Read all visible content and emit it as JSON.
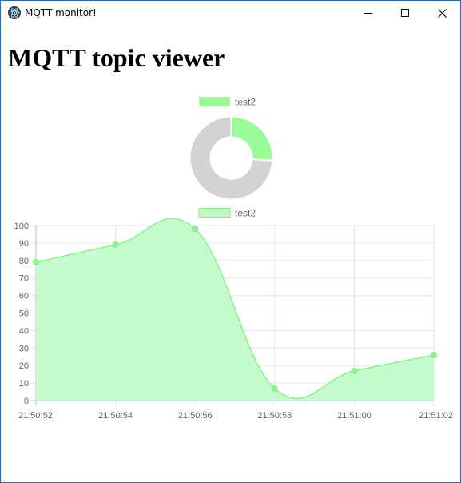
{
  "window": {
    "title": "MQTT monitor!",
    "minimize_icon": "minimize-icon",
    "maximize_icon": "maximize-icon",
    "close_icon": "close-icon",
    "app_icon": "electron-icon"
  },
  "page": {
    "heading": "MQTT topic viewer"
  },
  "chart_data": [
    {
      "type": "pie",
      "variant": "doughnut",
      "legend": [
        "test2"
      ],
      "legend_position": "top",
      "values": [
        26,
        74
      ],
      "colors": [
        "#98fb98",
        "#d3d3d3"
      ]
    },
    {
      "type": "area",
      "legend": [
        "test2"
      ],
      "legend_position": "top",
      "x": [
        "21:50:52",
        "21:50:54",
        "21:50:56",
        "21:50:58",
        "21:51:00",
        "21:51:02"
      ],
      "series": [
        {
          "name": "test2",
          "values": [
            79,
            89,
            98,
            7,
            17,
            26
          ]
        }
      ],
      "ylim": [
        0,
        100
      ],
      "yticks": [
        "0",
        "10",
        "20",
        "30",
        "40",
        "50",
        "60",
        "70",
        "80",
        "90",
        "100"
      ],
      "grid": true,
      "line_color": "#7df27d",
      "fill_color": "#c1fac9",
      "point_color": "#8ef28e"
    }
  ]
}
